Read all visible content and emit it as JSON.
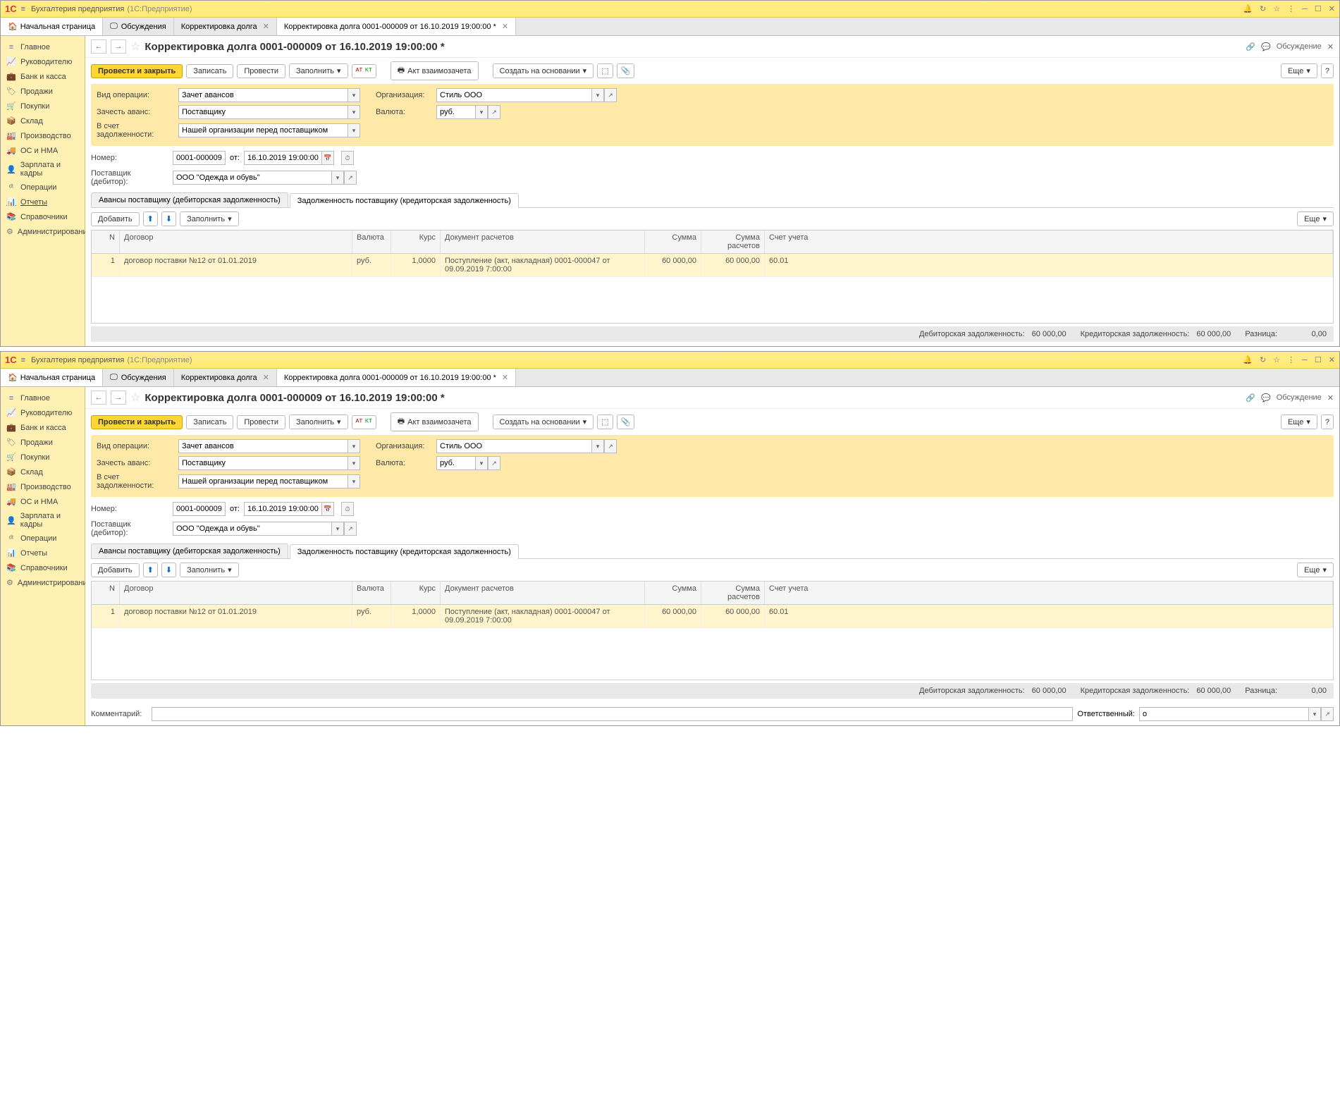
{
  "app": {
    "title": "Бухгалтерия предприятия",
    "sub": "(1С:Предприятие)"
  },
  "tabs": {
    "home": "Начальная страница",
    "discuss": "Обсуждения",
    "t1": "Корректировка долга",
    "t2": "Корректировка долга 0001-000009 от 16.10.2019 19:00:00 *"
  },
  "sidebar": [
    "Главное",
    "Руководителю",
    "Банк и касса",
    "Продажи",
    "Покупки",
    "Склад",
    "Производство",
    "ОС и НМА",
    "Зарплата и кадры",
    "Операции",
    "Отчеты",
    "Справочники",
    "Администрирование"
  ],
  "sidebar_icons": [
    "≡",
    "📈",
    "💼",
    "🏷",
    "🛒",
    "📦",
    "🏭",
    "🚚",
    "👤",
    "ᵈᵗ",
    "📊",
    "📚",
    "⚙"
  ],
  "page": {
    "title": "Корректировка долга 0001-000009 от 16.10.2019 19:00:00 *",
    "discuss": "Обсуждение"
  },
  "toolbar": {
    "post_close": "Провести и закрыть",
    "save": "Записать",
    "post": "Провести",
    "fill": "Заполнить",
    "print": "Акт взаимозачета",
    "create_based": "Создать на основании",
    "more": "Еще"
  },
  "form": {
    "op_label": "Вид операции:",
    "op_val": "Зачет авансов",
    "adv_label": "Зачесть аванс:",
    "adv_val": "Поставщику",
    "debt_label": "В счет задолженности:",
    "debt_val": "Нашей организации перед поставщиком",
    "org_label": "Организация:",
    "org_val": "Стиль ООО",
    "cur_label": "Валюта:",
    "cur_val": "руб.",
    "num_label": "Номер:",
    "num_val": "0001-000009",
    "from": "от:",
    "date_val": "16.10.2019 19:00:00",
    "supplier_label": "Поставщик (дебитор):",
    "supplier_val": "ООО \"Одежда и обувь\""
  },
  "doctabs": {
    "t1": "Авансы поставщику (дебиторская задолженность)",
    "t2": "Задолженность поставщику (кредиторская задолженность)"
  },
  "tablebar": {
    "add": "Добавить",
    "fill": "Заполнить",
    "more": "Еще"
  },
  "grid": {
    "hdr": {
      "n": "N",
      "dog": "Договор",
      "val": "Валюта",
      "kurs": "Курс",
      "doc": "Документ расчетов",
      "sum": "Сумма",
      "sumr": "Сумма расчетов",
      "acc": "Счет учета"
    },
    "row": {
      "n": "1",
      "dog": "договор поставки №12 от 01.01.2019",
      "val": "руб.",
      "kurs": "1,0000",
      "doc": "Поступление (акт, накладная) 0001-000047 от 09.09.2019 7:00:00",
      "sum": "60 000,00",
      "sumr": "60 000,00",
      "acc": "60.01"
    }
  },
  "footer": {
    "deb_label": "Дебиторская задолженность:",
    "deb_val": "60 000,00",
    "cred_label": "Кредиторская задолженность:",
    "cred_val": "60 000,00",
    "diff_label": "Разница:",
    "diff_val": "0,00"
  },
  "comment": {
    "label": "Комментарий:",
    "resp_label": "Ответственный:",
    "resp_val": "о"
  }
}
